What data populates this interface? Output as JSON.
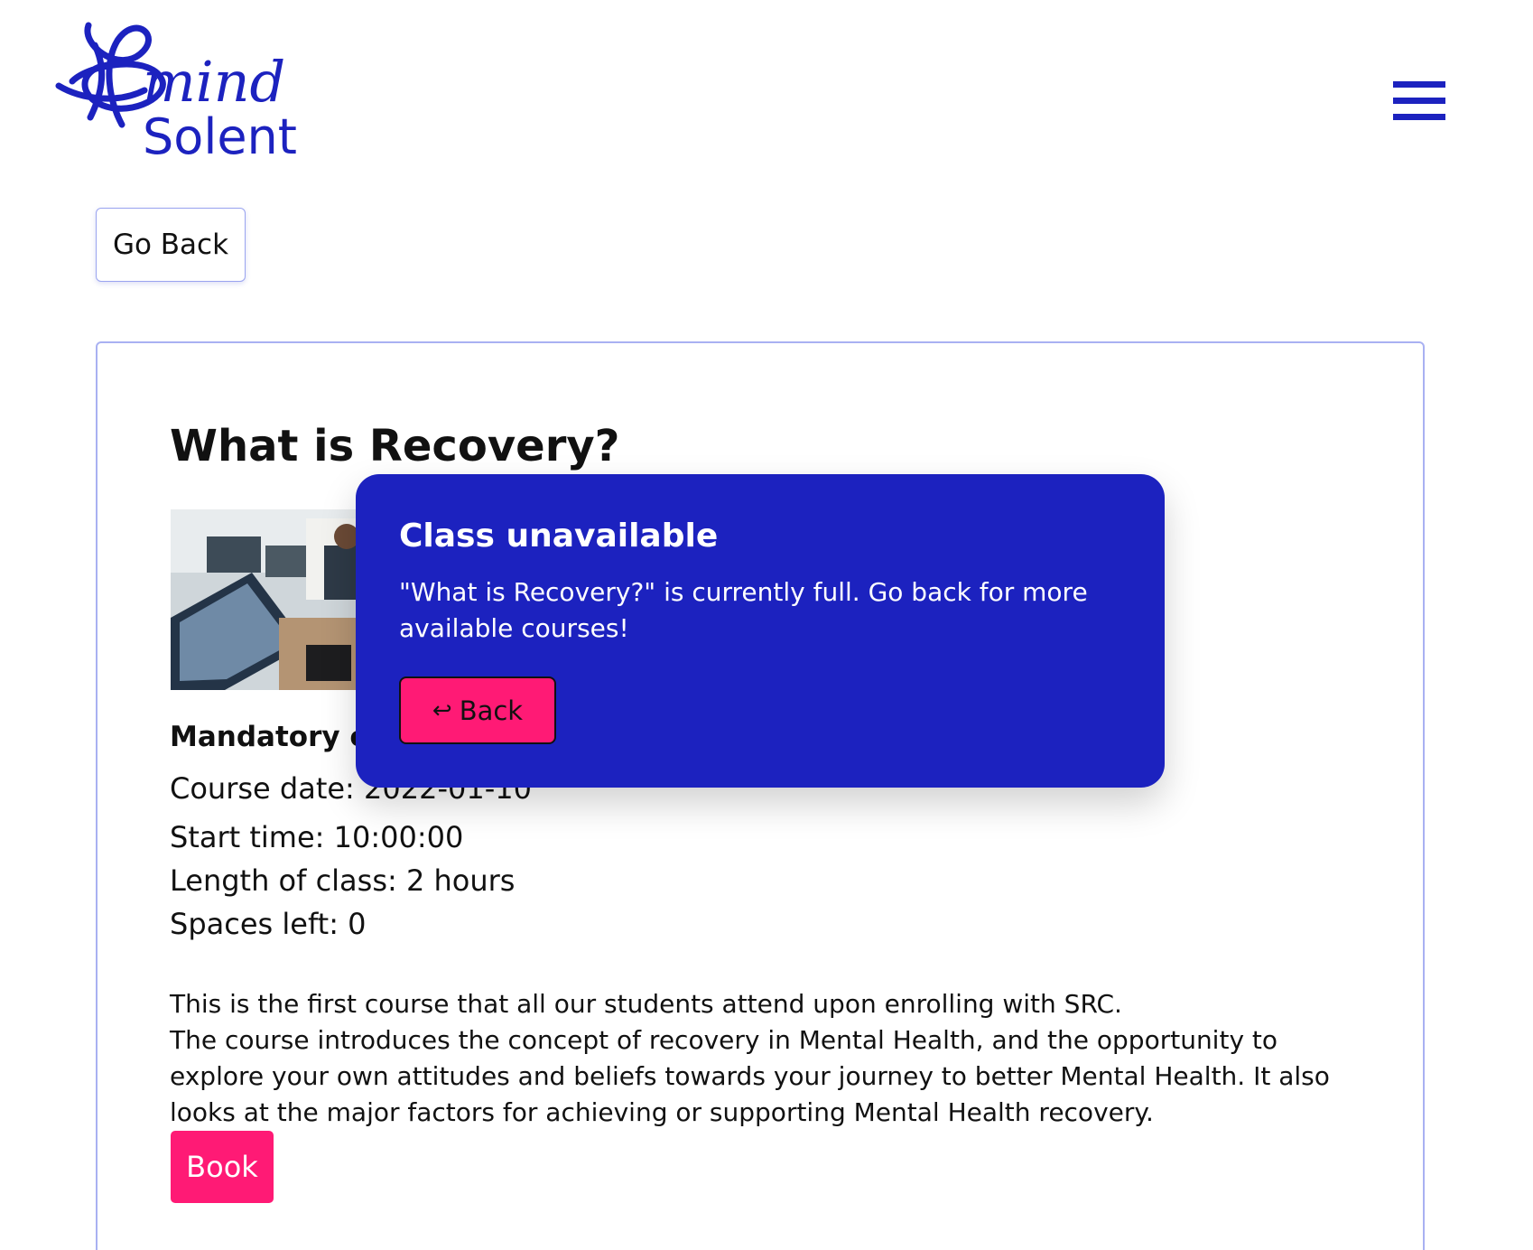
{
  "brand": {
    "logo_word_top": "mind",
    "logo_word_bottom": "Solent",
    "color": "#1c22bf"
  },
  "header": {
    "menu_icon": "hamburger-menu-icon"
  },
  "nav": {
    "go_back_label": "Go Back"
  },
  "course": {
    "title": "What is Recovery?",
    "mandatory_label": "Mandatory c",
    "date_line": "Course date: 2022-01-10",
    "start_line": "Start time: 10:00:00",
    "length_line": "Length of class: 2 hours",
    "spaces_line": "Spaces left: 0",
    "description_1": "This is the first course that all our students attend upon enrolling with SRC.",
    "description_2": "The course introduces the concept of recovery in Mental Health, and the opportunity to explore your own attitudes and beliefs towards your journey to better Mental Health. It also looks at the major factors for achieving or supporting Mental Health recovery.",
    "book_label": "Book",
    "book_color": "#ff1a75"
  },
  "modal": {
    "title": "Class unavailable",
    "message": "\"What is Recovery?\" is currently full. Go back for more available courses!",
    "back_icon": "return-arrow-icon",
    "back_label": "Back",
    "background": "#1c22bf"
  }
}
